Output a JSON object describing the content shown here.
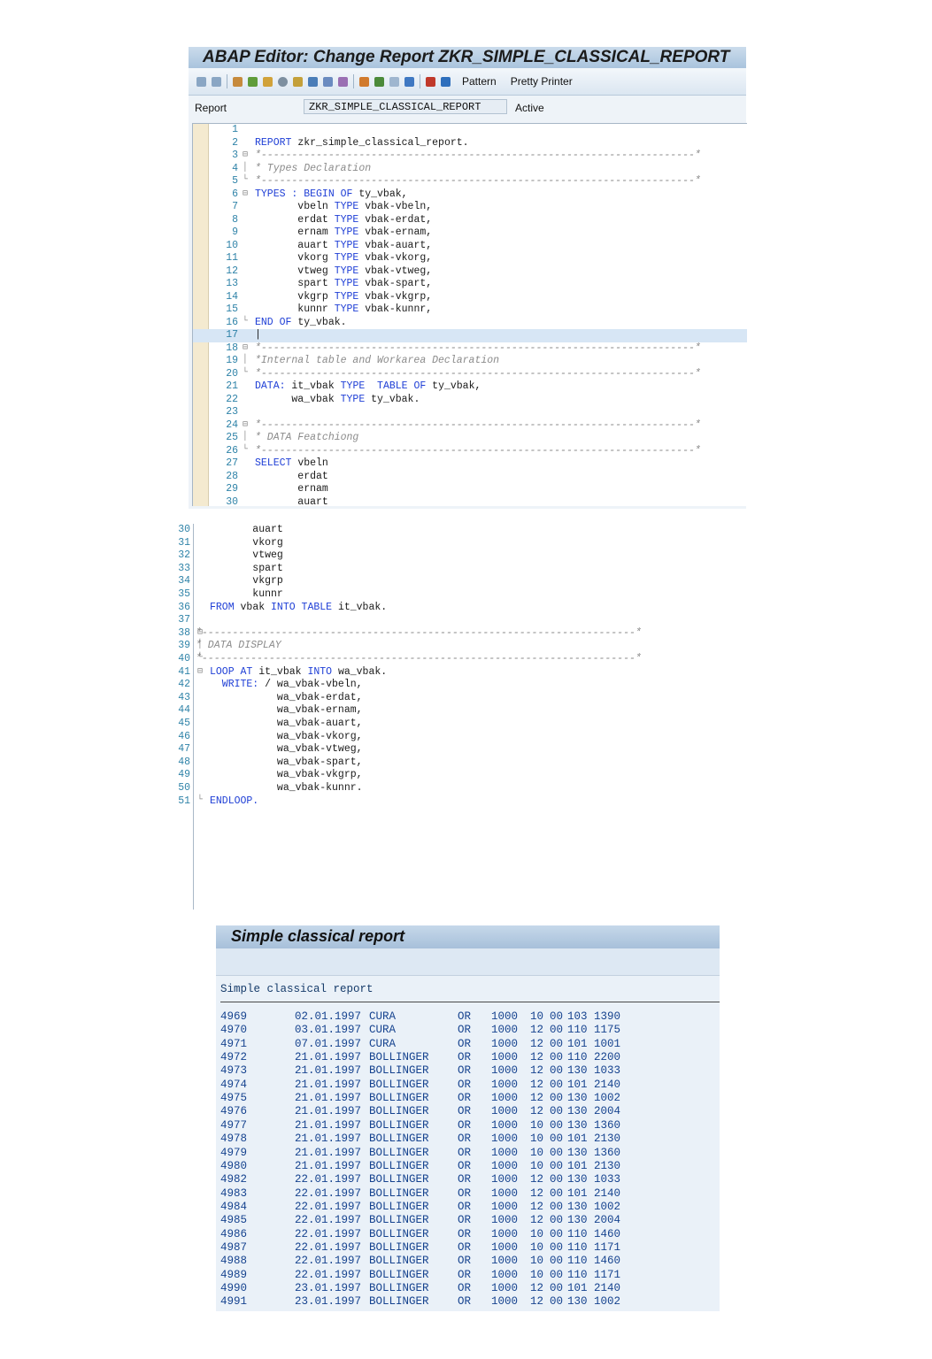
{
  "editor": {
    "title": "ABAP Editor: Change Report ZKR_SIMPLE_CLASSICAL_REPORT",
    "toolbar": {
      "pattern_label": "Pattern",
      "pretty_printer_label": "Pretty Printer"
    },
    "report_label": "Report",
    "report_name": "ZKR_SIMPLE_CLASSICAL_REPORT",
    "status": "Active",
    "lines": [
      {
        "n": "1",
        "fold": "",
        "parts": []
      },
      {
        "n": "2",
        "fold": "",
        "parts": [
          {
            "t": "REPORT",
            "c": "kw"
          },
          {
            "t": " zkr_simple_classical_report.",
            "c": ""
          }
        ]
      },
      {
        "n": "3",
        "fold": "⊟",
        "parts": [
          {
            "t": "*-----------------------------------------------------------------------*",
            "c": "cm"
          }
        ]
      },
      {
        "n": "4",
        "fold": "│",
        "parts": [
          {
            "t": "* Types Declaration",
            "c": "cm"
          }
        ]
      },
      {
        "n": "5",
        "fold": "└",
        "parts": [
          {
            "t": "*-----------------------------------------------------------------------*",
            "c": "cm"
          }
        ]
      },
      {
        "n": "6",
        "fold": "⊟",
        "parts": [
          {
            "t": "TYPES : BEGIN OF",
            "c": "kw"
          },
          {
            "t": " ty_vbak,",
            "c": ""
          }
        ]
      },
      {
        "n": "7",
        "fold": "",
        "parts": [
          {
            "t": "       vbeln ",
            "c": ""
          },
          {
            "t": "TYPE",
            "c": "kw"
          },
          {
            "t": " vbak-vbeln,",
            "c": ""
          }
        ]
      },
      {
        "n": "8",
        "fold": "",
        "parts": [
          {
            "t": "       erdat ",
            "c": ""
          },
          {
            "t": "TYPE",
            "c": "kw"
          },
          {
            "t": " vbak-erdat,",
            "c": ""
          }
        ]
      },
      {
        "n": "9",
        "fold": "",
        "parts": [
          {
            "t": "       ernam ",
            "c": ""
          },
          {
            "t": "TYPE",
            "c": "kw"
          },
          {
            "t": " vbak-ernam,",
            "c": ""
          }
        ]
      },
      {
        "n": "10",
        "fold": "",
        "parts": [
          {
            "t": "       auart ",
            "c": ""
          },
          {
            "t": "TYPE",
            "c": "kw"
          },
          {
            "t": " vbak-auart,",
            "c": ""
          }
        ]
      },
      {
        "n": "11",
        "fold": "",
        "parts": [
          {
            "t": "       vkorg ",
            "c": ""
          },
          {
            "t": "TYPE",
            "c": "kw"
          },
          {
            "t": " vbak-vkorg,",
            "c": ""
          }
        ]
      },
      {
        "n": "12",
        "fold": "",
        "parts": [
          {
            "t": "       vtweg ",
            "c": ""
          },
          {
            "t": "TYPE",
            "c": "kw"
          },
          {
            "t": " vbak-vtweg,",
            "c": ""
          }
        ]
      },
      {
        "n": "13",
        "fold": "",
        "parts": [
          {
            "t": "       spart ",
            "c": ""
          },
          {
            "t": "TYPE",
            "c": "kw"
          },
          {
            "t": " vbak-spart,",
            "c": ""
          }
        ]
      },
      {
        "n": "14",
        "fold": "",
        "parts": [
          {
            "t": "       vkgrp ",
            "c": ""
          },
          {
            "t": "TYPE",
            "c": "kw"
          },
          {
            "t": " vbak-vkgrp,",
            "c": ""
          }
        ]
      },
      {
        "n": "15",
        "fold": "",
        "parts": [
          {
            "t": "       kunnr ",
            "c": ""
          },
          {
            "t": "TYPE",
            "c": "kw"
          },
          {
            "t": " vbak-kunnr,",
            "c": ""
          }
        ]
      },
      {
        "n": "16",
        "fold": "└",
        "parts": [
          {
            "t": "END OF",
            "c": "kw"
          },
          {
            "t": " ty_vbak.",
            "c": ""
          }
        ]
      },
      {
        "n": "17",
        "fold": "",
        "parts": [
          {
            "t": "|",
            "c": ""
          }
        ],
        "cur": true
      },
      {
        "n": "18",
        "fold": "⊟",
        "parts": [
          {
            "t": "*-----------------------------------------------------------------------*",
            "c": "cm"
          }
        ]
      },
      {
        "n": "19",
        "fold": "│",
        "parts": [
          {
            "t": "*Internal table and Workarea Declaration",
            "c": "cm"
          }
        ]
      },
      {
        "n": "20",
        "fold": "└",
        "parts": [
          {
            "t": "*-----------------------------------------------------------------------*",
            "c": "cm"
          }
        ]
      },
      {
        "n": "21",
        "fold": "",
        "parts": [
          {
            "t": "DATA:",
            "c": "kw"
          },
          {
            "t": " it_vbak ",
            "c": ""
          },
          {
            "t": "TYPE  TABLE OF",
            "c": "kw"
          },
          {
            "t": " ty_vbak,",
            "c": ""
          }
        ]
      },
      {
        "n": "22",
        "fold": "",
        "parts": [
          {
            "t": "      wa_vbak ",
            "c": ""
          },
          {
            "t": "TYPE",
            "c": "kw"
          },
          {
            "t": " ty_vbak.",
            "c": ""
          }
        ]
      },
      {
        "n": "23",
        "fold": "",
        "parts": []
      },
      {
        "n": "24",
        "fold": "⊟",
        "parts": [
          {
            "t": "*-----------------------------------------------------------------------*",
            "c": "cm"
          }
        ]
      },
      {
        "n": "25",
        "fold": "│",
        "parts": [
          {
            "t": "* DATA Featchiong",
            "c": "cm"
          }
        ]
      },
      {
        "n": "26",
        "fold": "└",
        "parts": [
          {
            "t": "*-----------------------------------------------------------------------*",
            "c": "cm"
          }
        ]
      },
      {
        "n": "27",
        "fold": "",
        "parts": [
          {
            "t": "SELECT",
            "c": "kw"
          },
          {
            "t": " vbeln",
            "c": ""
          }
        ]
      },
      {
        "n": "28",
        "fold": "",
        "parts": [
          {
            "t": "       erdat",
            "c": ""
          }
        ]
      },
      {
        "n": "29",
        "fold": "",
        "parts": [
          {
            "t": "       ernam",
            "c": ""
          }
        ]
      },
      {
        "n": "30",
        "fold": "",
        "parts": [
          {
            "t": "       auart",
            "c": ""
          }
        ]
      }
    ]
  },
  "code2": {
    "lines": [
      {
        "n": "30",
        "fold": "",
        "parts": [
          {
            "t": "       auart",
            "c": ""
          }
        ]
      },
      {
        "n": "31",
        "fold": "",
        "parts": [
          {
            "t": "       vkorg",
            "c": ""
          }
        ]
      },
      {
        "n": "32",
        "fold": "",
        "parts": [
          {
            "t": "       vtweg",
            "c": ""
          }
        ]
      },
      {
        "n": "33",
        "fold": "",
        "parts": [
          {
            "t": "       spart",
            "c": ""
          }
        ]
      },
      {
        "n": "34",
        "fold": "",
        "parts": [
          {
            "t": "       vkgrp",
            "c": ""
          }
        ]
      },
      {
        "n": "35",
        "fold": "",
        "parts": [
          {
            "t": "       kunnr",
            "c": ""
          }
        ]
      },
      {
        "n": "36",
        "fold": "",
        "parts": [
          {
            "t": "FROM",
            "c": "kw"
          },
          {
            "t": " vbak ",
            "c": ""
          },
          {
            "t": "INTO TABLE",
            "c": "kw"
          },
          {
            "t": " it_vbak.",
            "c": ""
          }
        ]
      },
      {
        "n": "37",
        "fold": "",
        "parts": []
      },
      {
        "n": "38",
        "fold": "⊟",
        "parts": [
          {
            "t": "*-----------------------------------------------------------------------*",
            "c": "cm",
            "shift": -16
          }
        ]
      },
      {
        "n": "39",
        "fold": "│",
        "parts": [
          {
            "t": "* DATA DISPLAY",
            "c": "cm",
            "shift": -16
          }
        ]
      },
      {
        "n": "40",
        "fold": "└",
        "parts": [
          {
            "t": "*-----------------------------------------------------------------------*",
            "c": "cm",
            "shift": -16
          }
        ]
      },
      {
        "n": "41",
        "fold": "⊟",
        "parts": [
          {
            "t": "LOOP AT",
            "c": "kw"
          },
          {
            "t": " it_vbak ",
            "c": ""
          },
          {
            "t": "INTO",
            "c": "kw"
          },
          {
            "t": " wa_vbak.",
            "c": ""
          }
        ]
      },
      {
        "n": "42",
        "fold": "",
        "parts": [
          {
            "t": "  WRITE:",
            "c": "kw"
          },
          {
            "t": " / wa_vbak-vbeln,",
            "c": ""
          }
        ]
      },
      {
        "n": "43",
        "fold": "",
        "parts": [
          {
            "t": "           wa_vbak-erdat,",
            "c": ""
          }
        ]
      },
      {
        "n": "44",
        "fold": "",
        "parts": [
          {
            "t": "           wa_vbak-ernam,",
            "c": ""
          }
        ]
      },
      {
        "n": "45",
        "fold": "",
        "parts": [
          {
            "t": "           wa_vbak-auart,",
            "c": ""
          }
        ]
      },
      {
        "n": "46",
        "fold": "",
        "parts": [
          {
            "t": "           wa_vbak-vkorg,",
            "c": ""
          }
        ]
      },
      {
        "n": "47",
        "fold": "",
        "parts": [
          {
            "t": "           wa_vbak-vtweg,",
            "c": ""
          }
        ]
      },
      {
        "n": "48",
        "fold": "",
        "parts": [
          {
            "t": "           wa_vbak-spart,",
            "c": ""
          }
        ]
      },
      {
        "n": "49",
        "fold": "",
        "parts": [
          {
            "t": "           wa_vbak-vkgrp,",
            "c": ""
          }
        ]
      },
      {
        "n": "50",
        "fold": "",
        "parts": [
          {
            "t": "           wa_vbak-kunnr.",
            "c": ""
          }
        ]
      },
      {
        "n": "51",
        "fold": "└",
        "parts": [
          {
            "t": "ENDLOOP.",
            "c": "kw"
          }
        ]
      }
    ]
  },
  "report": {
    "window_title": "Simple classical report",
    "heading": "Simple classical report",
    "rows": [
      [
        "4969",
        "02.01.1997",
        "CURA",
        "OR",
        "1000",
        "10",
        "00",
        "103",
        "1390"
      ],
      [
        "4970",
        "03.01.1997",
        "CURA",
        "OR",
        "1000",
        "12",
        "00",
        "110",
        "1175"
      ],
      [
        "4971",
        "07.01.1997",
        "CURA",
        "OR",
        "1000",
        "12",
        "00",
        "101",
        "1001"
      ],
      [
        "4972",
        "21.01.1997",
        "BOLLINGER",
        "OR",
        "1000",
        "12",
        "00",
        "110",
        "2200"
      ],
      [
        "4973",
        "21.01.1997",
        "BOLLINGER",
        "OR",
        "1000",
        "12",
        "00",
        "130",
        "1033"
      ],
      [
        "4974",
        "21.01.1997",
        "BOLLINGER",
        "OR",
        "1000",
        "12",
        "00",
        "101",
        "2140"
      ],
      [
        "4975",
        "21.01.1997",
        "BOLLINGER",
        "OR",
        "1000",
        "12",
        "00",
        "130",
        "1002"
      ],
      [
        "4976",
        "21.01.1997",
        "BOLLINGER",
        "OR",
        "1000",
        "12",
        "00",
        "130",
        "2004"
      ],
      [
        "4977",
        "21.01.1997",
        "BOLLINGER",
        "OR",
        "1000",
        "10",
        "00",
        "130",
        "1360"
      ],
      [
        "4978",
        "21.01.1997",
        "BOLLINGER",
        "OR",
        "1000",
        "10",
        "00",
        "101",
        "2130"
      ],
      [
        "4979",
        "21.01.1997",
        "BOLLINGER",
        "OR",
        "1000",
        "10",
        "00",
        "130",
        "1360"
      ],
      [
        "4980",
        "21.01.1997",
        "BOLLINGER",
        "OR",
        "1000",
        "10",
        "00",
        "101",
        "2130"
      ],
      [
        "4982",
        "22.01.1997",
        "BOLLINGER",
        "OR",
        "1000",
        "12",
        "00",
        "130",
        "1033"
      ],
      [
        "4983",
        "22.01.1997",
        "BOLLINGER",
        "OR",
        "1000",
        "12",
        "00",
        "101",
        "2140"
      ],
      [
        "4984",
        "22.01.1997",
        "BOLLINGER",
        "OR",
        "1000",
        "12",
        "00",
        "130",
        "1002"
      ],
      [
        "4985",
        "22.01.1997",
        "BOLLINGER",
        "OR",
        "1000",
        "12",
        "00",
        "130",
        "2004"
      ],
      [
        "4986",
        "22.01.1997",
        "BOLLINGER",
        "OR",
        "1000",
        "10",
        "00",
        "110",
        "1460"
      ],
      [
        "4987",
        "22.01.1997",
        "BOLLINGER",
        "OR",
        "1000",
        "10",
        "00",
        "110",
        "1171"
      ],
      [
        "4988",
        "22.01.1997",
        "BOLLINGER",
        "OR",
        "1000",
        "10",
        "00",
        "110",
        "1460"
      ],
      [
        "4989",
        "22.01.1997",
        "BOLLINGER",
        "OR",
        "1000",
        "10",
        "00",
        "110",
        "1171"
      ],
      [
        "4990",
        "23.01.1997",
        "BOLLINGER",
        "OR",
        "1000",
        "12",
        "00",
        "101",
        "2140"
      ],
      [
        "4991",
        "23.01.1997",
        "BOLLINGER",
        "OR",
        "1000",
        "12",
        "00",
        "130",
        "1002"
      ]
    ]
  }
}
